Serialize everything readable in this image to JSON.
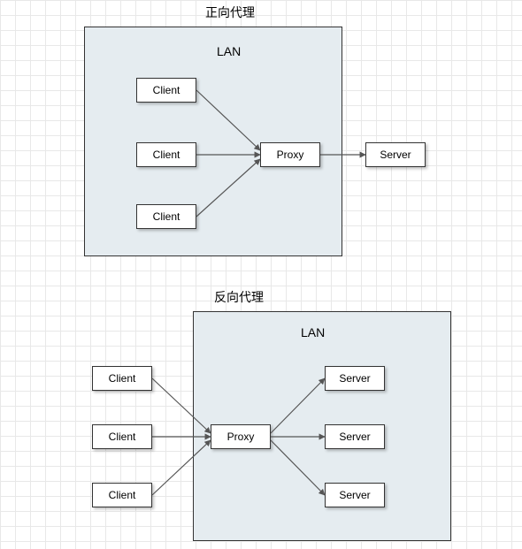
{
  "diagram1": {
    "title": "正向代理",
    "lan_label": "LAN",
    "clients": [
      "Client",
      "Client",
      "Client"
    ],
    "proxy": "Proxy",
    "server": "Server"
  },
  "diagram2": {
    "title": "反向代理",
    "lan_label": "LAN",
    "clients": [
      "Client",
      "Client",
      "Client"
    ],
    "proxy": "Proxy",
    "servers": [
      "Server",
      "Server",
      "Server"
    ]
  }
}
